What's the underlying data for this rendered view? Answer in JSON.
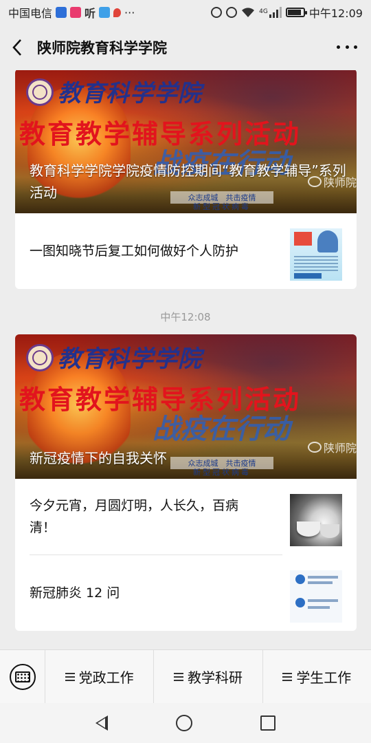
{
  "status_bar": {
    "carrier": "中国电信",
    "ting_label": "听",
    "dots": "···",
    "network": "4G",
    "time": "中午12:09"
  },
  "title_bar": {
    "title": "陕师院教育科学学院"
  },
  "articles_group_1": {
    "banner": {
      "brand": "教育科学学院",
      "headline": "教育教学辅导系列活动",
      "slogan": "战疫在行动",
      "sub1": "众志成城　共击疫情",
      "sub2": "新型冠状病毒",
      "watermark": "陕师院",
      "caption": "教育科学学院学院疫情防控期间“教育教学辅导”系列活动"
    },
    "items": [
      {
        "title": "一图知晓节后复工如何做好个人防护"
      }
    ]
  },
  "time_divider": "中午12:08",
  "articles_group_2": {
    "banner": {
      "brand": "教育科学学院",
      "headline": "教育教学辅导系列活动",
      "slogan": "战疫在行动",
      "sub1": "众志成城　共击疫情",
      "sub2": "新型冠状病毒",
      "watermark": "陕师院",
      "caption": "新冠疫情下的自我关怀"
    },
    "items": [
      {
        "title": "今夕元宵，月圆灯明，人长久，百病清！"
      },
      {
        "title": "新冠肺炎 12 问"
      }
    ]
  },
  "menu": {
    "items": [
      {
        "label": "党政工作"
      },
      {
        "label": "教学科研"
      },
      {
        "label": "学生工作"
      }
    ]
  },
  "colors": {
    "background": "#ededed",
    "card": "#ffffff",
    "banner_red": "#e2141d",
    "banner_blue": "#23318c"
  }
}
